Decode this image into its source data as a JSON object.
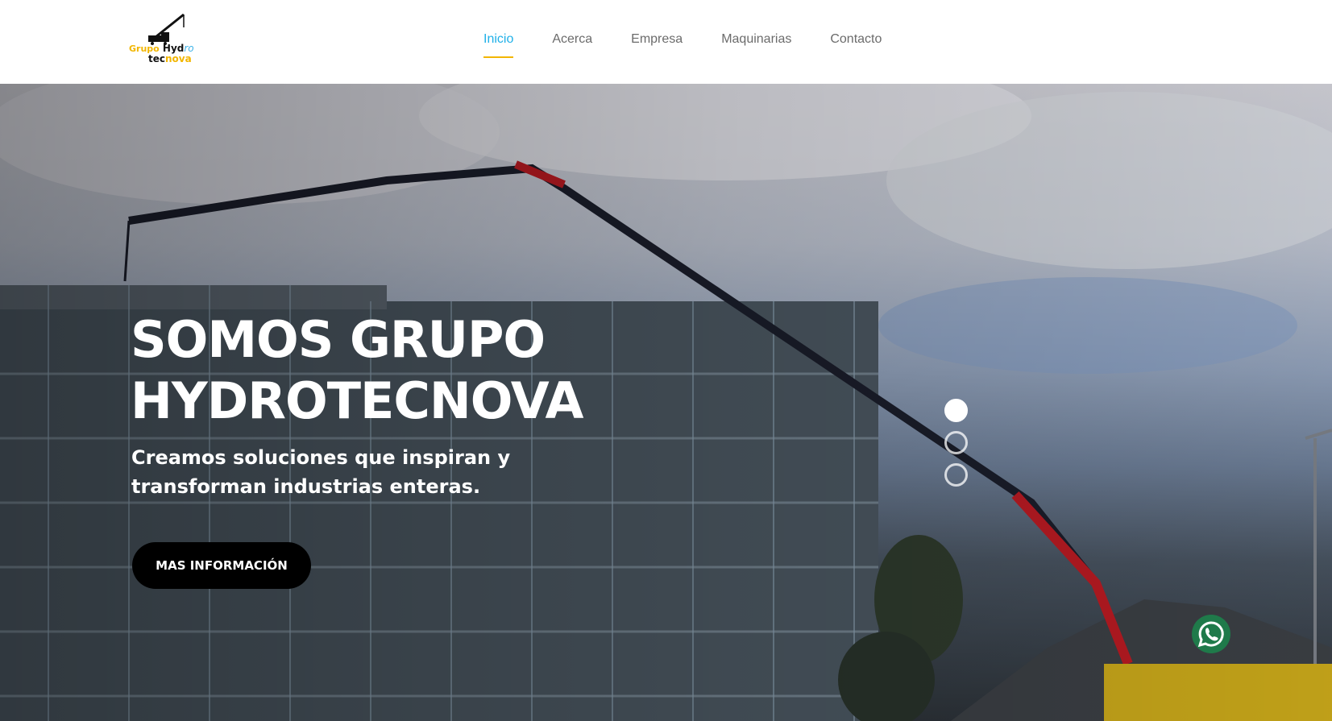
{
  "logo": {
    "line1_grupo": "Grupo",
    "line1_hyd": "Hyd",
    "line1_ro": "ro",
    "line2_tec": "tec",
    "line2_nova": "nova",
    "icon": "crane-icon"
  },
  "nav": {
    "items": [
      {
        "label": "Inicio",
        "active": true
      },
      {
        "label": "Acerca",
        "active": false
      },
      {
        "label": "Empresa",
        "active": false
      },
      {
        "label": "Maquinarias",
        "active": false
      },
      {
        "label": "Contacto",
        "active": false
      }
    ]
  },
  "hero": {
    "title_line1": "SOMOS GRUPO",
    "title_line2": "HYDROTECNOVA",
    "subtitle": "Creamos soluciones que inspiran y transforman industrias enteras.",
    "button_label": "MAS INFORMACIÓN",
    "slider": {
      "total": 3,
      "active": 1
    }
  },
  "whatsapp": {
    "icon": "whatsapp-icon"
  },
  "colors": {
    "accent_blue": "#1fb0e8",
    "accent_yellow": "#f2b600",
    "button_bg": "#000000",
    "whatsapp_green": "#1f7a4a"
  }
}
